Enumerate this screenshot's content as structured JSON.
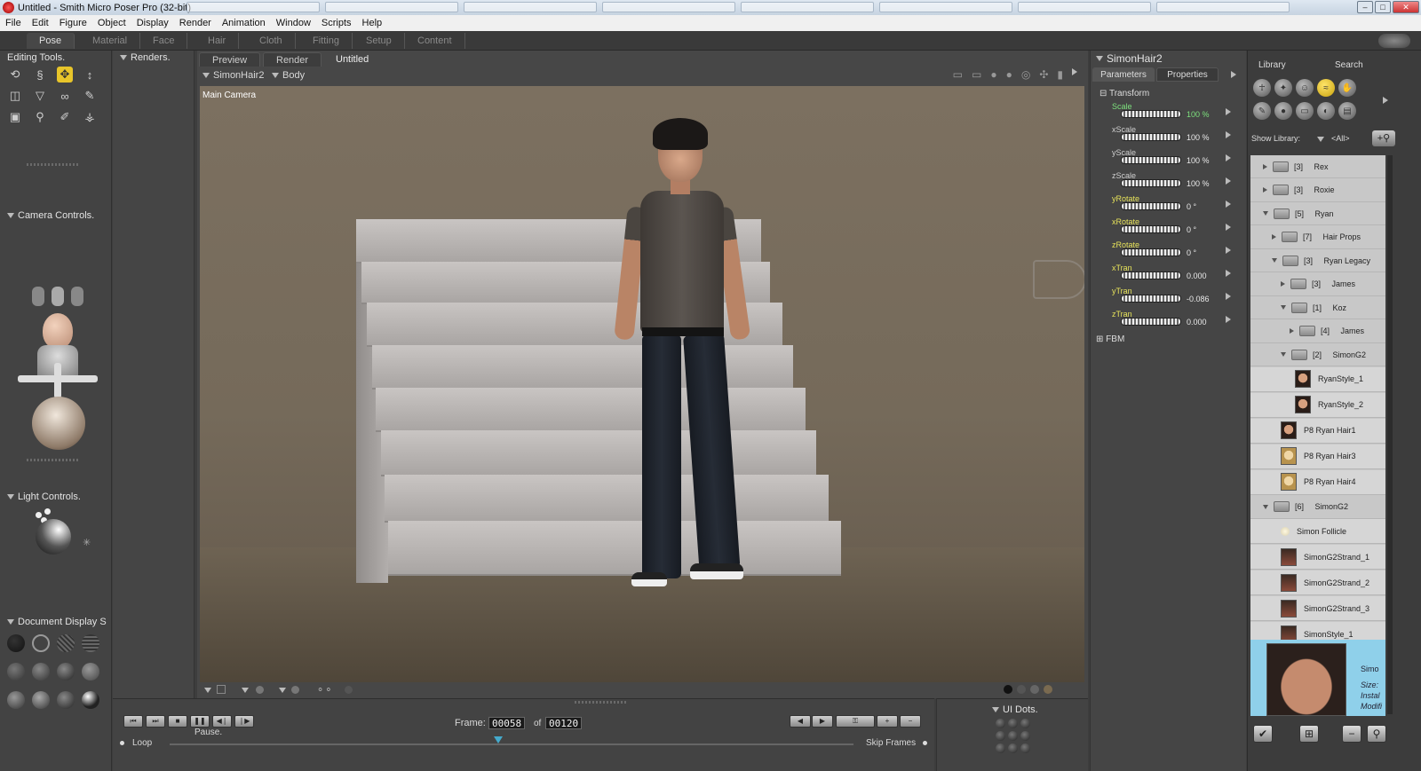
{
  "window": {
    "title": "Untitled - Smith Micro Poser Pro  (32-bit)"
  },
  "menu": [
    "File",
    "Edit",
    "Figure",
    "Object",
    "Display",
    "Render",
    "Animation",
    "Window",
    "Scripts",
    "Help"
  ],
  "rooms": [
    "Pose",
    "Material",
    "Face",
    "Hair",
    "Cloth",
    "Fitting",
    "Setup",
    "Content"
  ],
  "active_room": "Pose",
  "left_panels": {
    "editing_tools": "Editing Tools.",
    "camera_controls": "Camera Controls.",
    "light_controls": "Light Controls.",
    "document_display": "Document Display S"
  },
  "renders_panel": {
    "title": "Renders."
  },
  "viewport": {
    "tabs": [
      "Preview",
      "Render",
      "Untitled"
    ],
    "figure_selector": "SimonHair2",
    "part_selector": "Body",
    "camera_label": "Main Camera"
  },
  "animation": {
    "frame_label": "Frame:",
    "current_frame": "00058",
    "of_label": "of",
    "total_frames": "00120",
    "pause_label": "Pause.",
    "loop_label": "Loop",
    "skip_frames_label": "Skip Frames",
    "position": 0.48
  },
  "ui_dots": {
    "title": "UI Dots."
  },
  "parameters": {
    "object_name": "SimonHair2",
    "tabs": [
      "Parameters",
      "Properties"
    ],
    "group": "Transform",
    "items": [
      {
        "name": "Scale",
        "value": "100 %",
        "style": "green"
      },
      {
        "name": "xScale",
        "value": "100 %",
        "style": "normal"
      },
      {
        "name": "yScale",
        "value": "100 %",
        "style": "normal"
      },
      {
        "name": "zScale",
        "value": "100 %",
        "style": "normal"
      },
      {
        "name": "yRotate",
        "value": "0 °",
        "style": "hl"
      },
      {
        "name": "xRotate",
        "value": "0 °",
        "style": "hl"
      },
      {
        "name": "zRotate",
        "value": "0 °",
        "style": "hl"
      },
      {
        "name": "xTran",
        "value": "0.000",
        "style": "hl"
      },
      {
        "name": "yTran",
        "value": "-0.086",
        "style": "hl"
      },
      {
        "name": "zTran",
        "value": "0.000",
        "style": "hl"
      }
    ],
    "group2": "FBM"
  },
  "library": {
    "tabs": [
      "Library",
      "Search"
    ],
    "show_label": "Show Library:",
    "filter": "<All>",
    "rows": [
      {
        "label": "[3]     Rex",
        "kind": "folder",
        "state": "closed",
        "indent": 0
      },
      {
        "label": "[3]     Roxie",
        "kind": "folder",
        "state": "closed",
        "indent": 0
      },
      {
        "label": "[5]     Ryan",
        "kind": "folder",
        "state": "open",
        "indent": 0
      },
      {
        "label": "[7]     Hair Props",
        "kind": "folder",
        "state": "closed",
        "indent": 1
      },
      {
        "label": "[3]     Ryan Legacy",
        "kind": "folder",
        "state": "open",
        "indent": 1
      },
      {
        "label": "[3]     James",
        "kind": "folder",
        "state": "closed",
        "indent": 2
      },
      {
        "label": "[1]     Koz",
        "kind": "folder",
        "state": "open",
        "indent": 2
      },
      {
        "label": "[4]     James",
        "kind": "folder",
        "state": "closed",
        "indent": 3
      },
      {
        "label": "[2]     SimonG2",
        "kind": "folder",
        "state": "open",
        "indent": 2
      },
      {
        "label": "RyanStyle_1",
        "kind": "item",
        "thumb": "dark-hair",
        "indent": 3
      },
      {
        "label": "RyanStyle_2",
        "kind": "item",
        "thumb": "dark-hair",
        "indent": 3
      },
      {
        "label": "P8 Ryan Hair1",
        "kind": "item",
        "thumb": "dark-hair",
        "indent": 1
      },
      {
        "label": "P8 Ryan Hair3",
        "kind": "item",
        "thumb": "light-hair",
        "indent": 1
      },
      {
        "label": "P8 Ryan Hair4",
        "kind": "item",
        "thumb": "light-hair",
        "indent": 1
      },
      {
        "label": "[6]     SimonG2",
        "kind": "folder",
        "state": "open",
        "indent": 0
      },
      {
        "label": "Simon Follicle",
        "kind": "item",
        "thumb": "none",
        "indent": 1
      },
      {
        "label": "SimonG2Strand_1",
        "kind": "item",
        "thumb": "strand",
        "indent": 1
      },
      {
        "label": "SimonG2Strand_2",
        "kind": "item",
        "thumb": "strand",
        "indent": 1
      },
      {
        "label": "SimonG2Strand_3",
        "kind": "item",
        "thumb": "strand",
        "indent": 1
      },
      {
        "label": "SimonStyle_1",
        "kind": "item",
        "thumb": "strand",
        "indent": 1
      }
    ],
    "preview": {
      "name": "Simo",
      "size": "Size:",
      "installed": "Instal",
      "modified": "Modifi"
    }
  },
  "colors": {
    "accent_yellow": "#e8c52a",
    "selected_blue": "#8fd0ea",
    "panel_bg": "#434343"
  }
}
